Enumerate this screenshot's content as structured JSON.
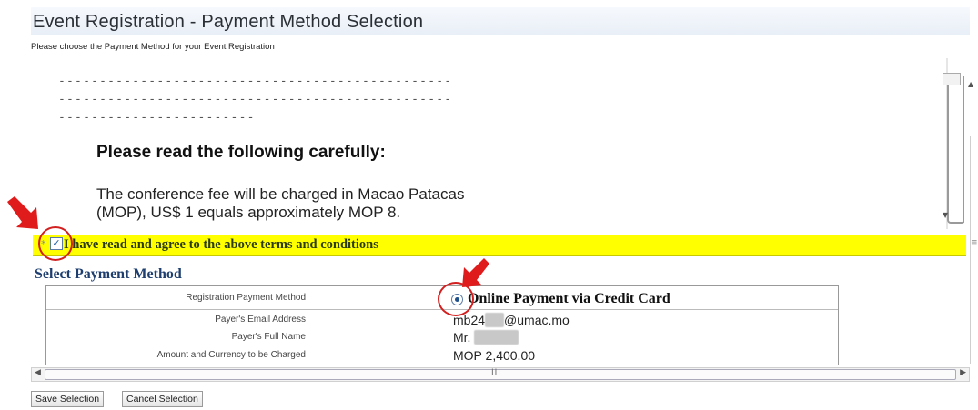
{
  "header": {
    "title": "Event Registration - Payment Method Selection",
    "subtitle": "Please choose the Payment Method for your Event Registration"
  },
  "terms": {
    "dash_line_1": "------------------------------------------------",
    "dash_line_2": "------------------------------------------------",
    "dash_line_3": "------------------------",
    "heading": "Please read the following carefully:",
    "line_1": "The conference fee will be charged in Macao Patacas",
    "line_2": "(MOP), US$ 1 equals approximately MOP 8."
  },
  "agreement": {
    "required_marker": "*",
    "label": "I have read and agree to the above terms and conditions",
    "checked": true
  },
  "payment": {
    "section_title": "Select Payment Method",
    "rows": [
      {
        "label": "Registration Payment Method",
        "value": "Online Payment via Credit Card"
      },
      {
        "label": "Payer's Email Address",
        "value_prefix": "mb24",
        "value_redacted": "xxx",
        "value_suffix": "@umac.mo"
      },
      {
        "label": "Payer's Full Name",
        "value_prefix": "Mr.",
        "value_redacted": "xxxxxxx"
      },
      {
        "label": "Amount and Currency to be Charged",
        "value": "MOP 2,400.00"
      }
    ]
  },
  "scrollbar": {
    "grip": "III"
  },
  "buttons": {
    "save": "Save Selection",
    "cancel": "Cancel Selection"
  },
  "colors": {
    "highlight": "#ffff00",
    "annotation": "#d21f1f",
    "section_title": "#1d3e6e"
  }
}
